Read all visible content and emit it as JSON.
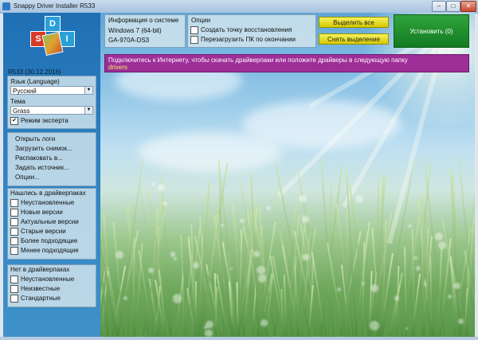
{
  "window": {
    "title": "Snappy Driver Installer R533",
    "min_glyph": "–",
    "max_glyph": "□",
    "close_glyph": "✕"
  },
  "logo": {
    "letters": [
      "S",
      "D",
      "I"
    ]
  },
  "sidebar": {
    "version": "R533 (30.12.2016)",
    "language_label": "Язык (Language)",
    "language_value": "Русский",
    "theme_label": "Тема",
    "theme_value": "Grass",
    "expert_mode": {
      "label": "Режим эксперта",
      "checked": true
    },
    "menu": [
      "Открыть логи",
      "Загрузить снимок...",
      "Распаковать в...",
      "Задать источник...",
      "Опции..."
    ],
    "found_group": {
      "title": "Нашлись в драйверпаках",
      "items": [
        {
          "label": "Неустановленные",
          "checked": false
        },
        {
          "label": "Новые версии",
          "checked": false
        },
        {
          "label": "Актуальные версии",
          "checked": false
        },
        {
          "label": "Старые версии",
          "checked": false
        },
        {
          "label": "Более подходящие",
          "checked": false
        },
        {
          "label": "Менее подходящие",
          "checked": false
        }
      ]
    },
    "missing_group": {
      "title": "Нет в драйверпаках",
      "items": [
        {
          "label": "Неустановленные",
          "checked": false
        },
        {
          "label": "Неизвестные",
          "checked": false
        },
        {
          "label": "Стандартные",
          "checked": false
        }
      ]
    }
  },
  "system_info": {
    "title": "Информация о системе",
    "os": "Windows 7 (64-bit)",
    "board": "GA-970A-DS3"
  },
  "options": {
    "title": "Опции",
    "restore_point": {
      "label": "Создать точку восстановления",
      "checked": false
    },
    "reboot": {
      "label": "Перезагрузить ПК по окончании",
      "checked": false
    }
  },
  "buttons": {
    "select_all": "Выделить все",
    "deselect": "Снять выделение",
    "install": "Установить (0)"
  },
  "message": {
    "text": "Подключитесь к Интернету, чтобы скачать драйверпаки или положите драйверы в следующую папку",
    "link": "drivers"
  },
  "colors": {
    "accent_sidebar": "#2f84c4",
    "message_bg": "#9e2e98",
    "install_green": "#1f8f2e",
    "button_yellow": "#e8e020"
  },
  "icons": {
    "app": "app-icon",
    "logo": "sdi-logo-icon",
    "dropdown": "chevron-down-icon",
    "check": "checkmark-icon"
  }
}
